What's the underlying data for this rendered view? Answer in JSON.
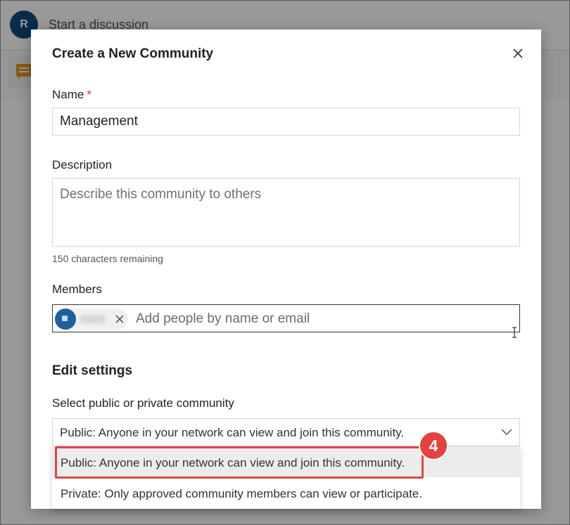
{
  "background": {
    "avatar_initial": "R",
    "start_discussion": "Start a discussion"
  },
  "modal": {
    "title": "Create a New Community",
    "name": {
      "label": "Name",
      "required_mark": "*",
      "value": "Management"
    },
    "description": {
      "label": "Description",
      "placeholder": "Describe this community to others",
      "chars_remaining": "150 characters remaining"
    },
    "members": {
      "label": "Members",
      "placeholder": "Add people by name or email"
    },
    "edit_settings": {
      "title": "Edit settings",
      "privacy_label": "Select public or private community",
      "selected_value": "Public: Anyone in your network can view and join this community.",
      "options": [
        "Public: Anyone in your network can view and join this community.",
        "Private: Only approved community members can view or participate."
      ]
    }
  },
  "annotation": {
    "step_number": "4",
    "color": "#e4413f"
  },
  "icons": {
    "close": "close-icon",
    "chevron": "chevron-down-icon",
    "chip_remove": "close-icon",
    "chat": "chat-icon"
  }
}
